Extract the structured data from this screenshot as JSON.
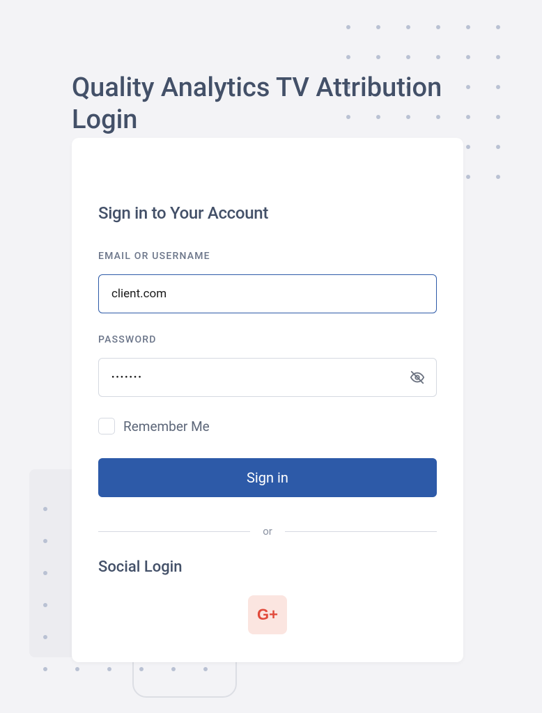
{
  "page": {
    "title": "Quality Analytics TV Attribution Login"
  },
  "form": {
    "heading": "Sign in to Your Account",
    "email": {
      "label": "EMAIL OR USERNAME",
      "value": "client.com"
    },
    "password": {
      "label": "PASSWORD",
      "value": "•••••••"
    },
    "remember": {
      "label": "Remember Me",
      "checked": false
    },
    "submit_label": "Sign in",
    "divider_text": "or",
    "social": {
      "heading": "Social Login",
      "google_label": "G+"
    }
  }
}
